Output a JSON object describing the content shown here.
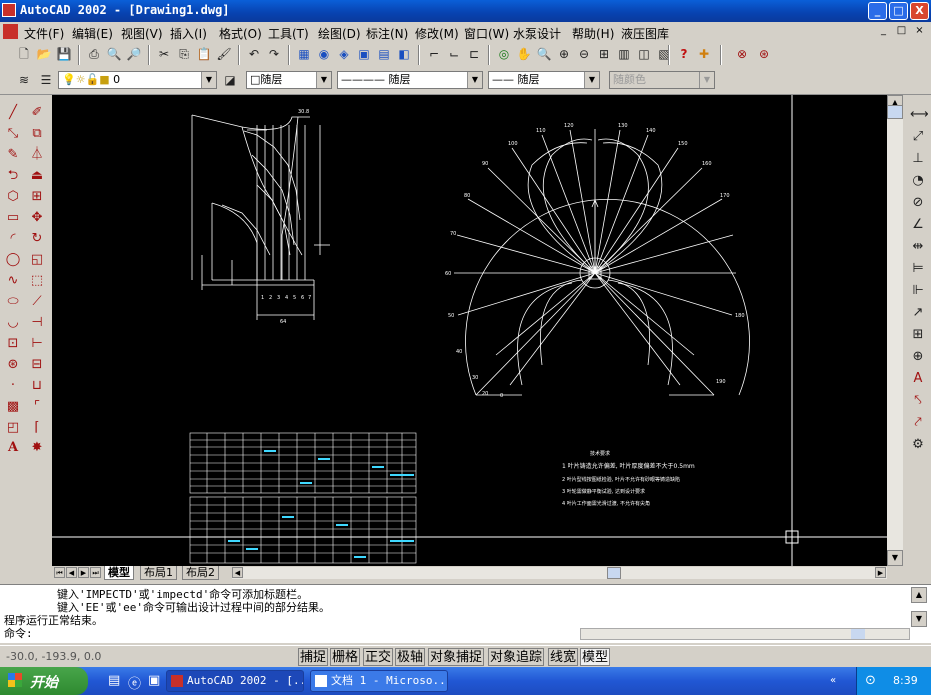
{
  "window": {
    "title": "AutoCAD 2002 - [Drawing1.dwg]",
    "controls": {
      "minimize": "_",
      "maximize": "□",
      "close": "X"
    }
  },
  "menu": {
    "items": [
      "文件(F)",
      "编辑(E)",
      "视图(V)",
      "插入(I)",
      "格式(O)",
      "工具(T)",
      "绘图(D)",
      "标注(N)",
      "修改(M)",
      "窗口(W)",
      "水泵设计",
      "帮助(H)",
      "液压图库"
    ],
    "doc_controls": [
      "_",
      "□",
      "×"
    ]
  },
  "properties_bar": {
    "layer_value": "0",
    "color_value": "□随层",
    "linetype_value": "———— 随层",
    "lineweight_value": "—— 随层",
    "plotstyle_value": "随颜色"
  },
  "drawing": {
    "left_dims": {
      "top_dim": "30.8",
      "bottom_dim": "64",
      "point_labels": [
        "1",
        "2",
        "3",
        "4",
        "5",
        "6",
        "7"
      ]
    },
    "polar_angles": [
      "120",
      "130",
      "110",
      "140",
      "100",
      "150",
      "90",
      "160",
      "80",
      "170",
      "70",
      "60",
      "50",
      "40",
      "30",
      "20",
      "0",
      "180",
      "190"
    ],
    "notes_title": "技术要求",
    "notes": [
      "1 叶片铸造允许偏差, 叶片厚度偏差不大于0.5mm",
      "2 叶片型线按图纸检验, 叶片不允许有砂眼等铸造缺陷",
      "3 叶轮需做静平衡试验, 达到设计要求",
      "4 叶片工作面需光滑过渡, 不允许有尖角"
    ]
  },
  "layout_tabs": [
    "模型",
    "布局1",
    "布局2"
  ],
  "command_window": {
    "lines": [
      "        键入'IMPECTD'或'impectd'命令可添加标题栏。",
      "        键入'EE'或'ee'命令可输出设计过程中间的部分结果。",
      "程序运行正常结束。",
      "命令:"
    ]
  },
  "status_bar": {
    "coordinates": "-30.0, -193.9, 0.0",
    "toggles": [
      "捕捉",
      "栅格",
      "正交",
      "极轴",
      "对象捕捉",
      "对象追踪",
      "线宽",
      "模型"
    ]
  },
  "taskbar": {
    "start_label": "开始",
    "tasks": [
      "AutoCAD 2002 - [...",
      "文档 1 - Microso..."
    ],
    "clock": "8:39"
  },
  "colors": {
    "titlebar": "#0a5fd8",
    "canvas_bg": "#000000",
    "drawing_lines": "#ffffff",
    "table_cyan": "#3fd8ff"
  }
}
